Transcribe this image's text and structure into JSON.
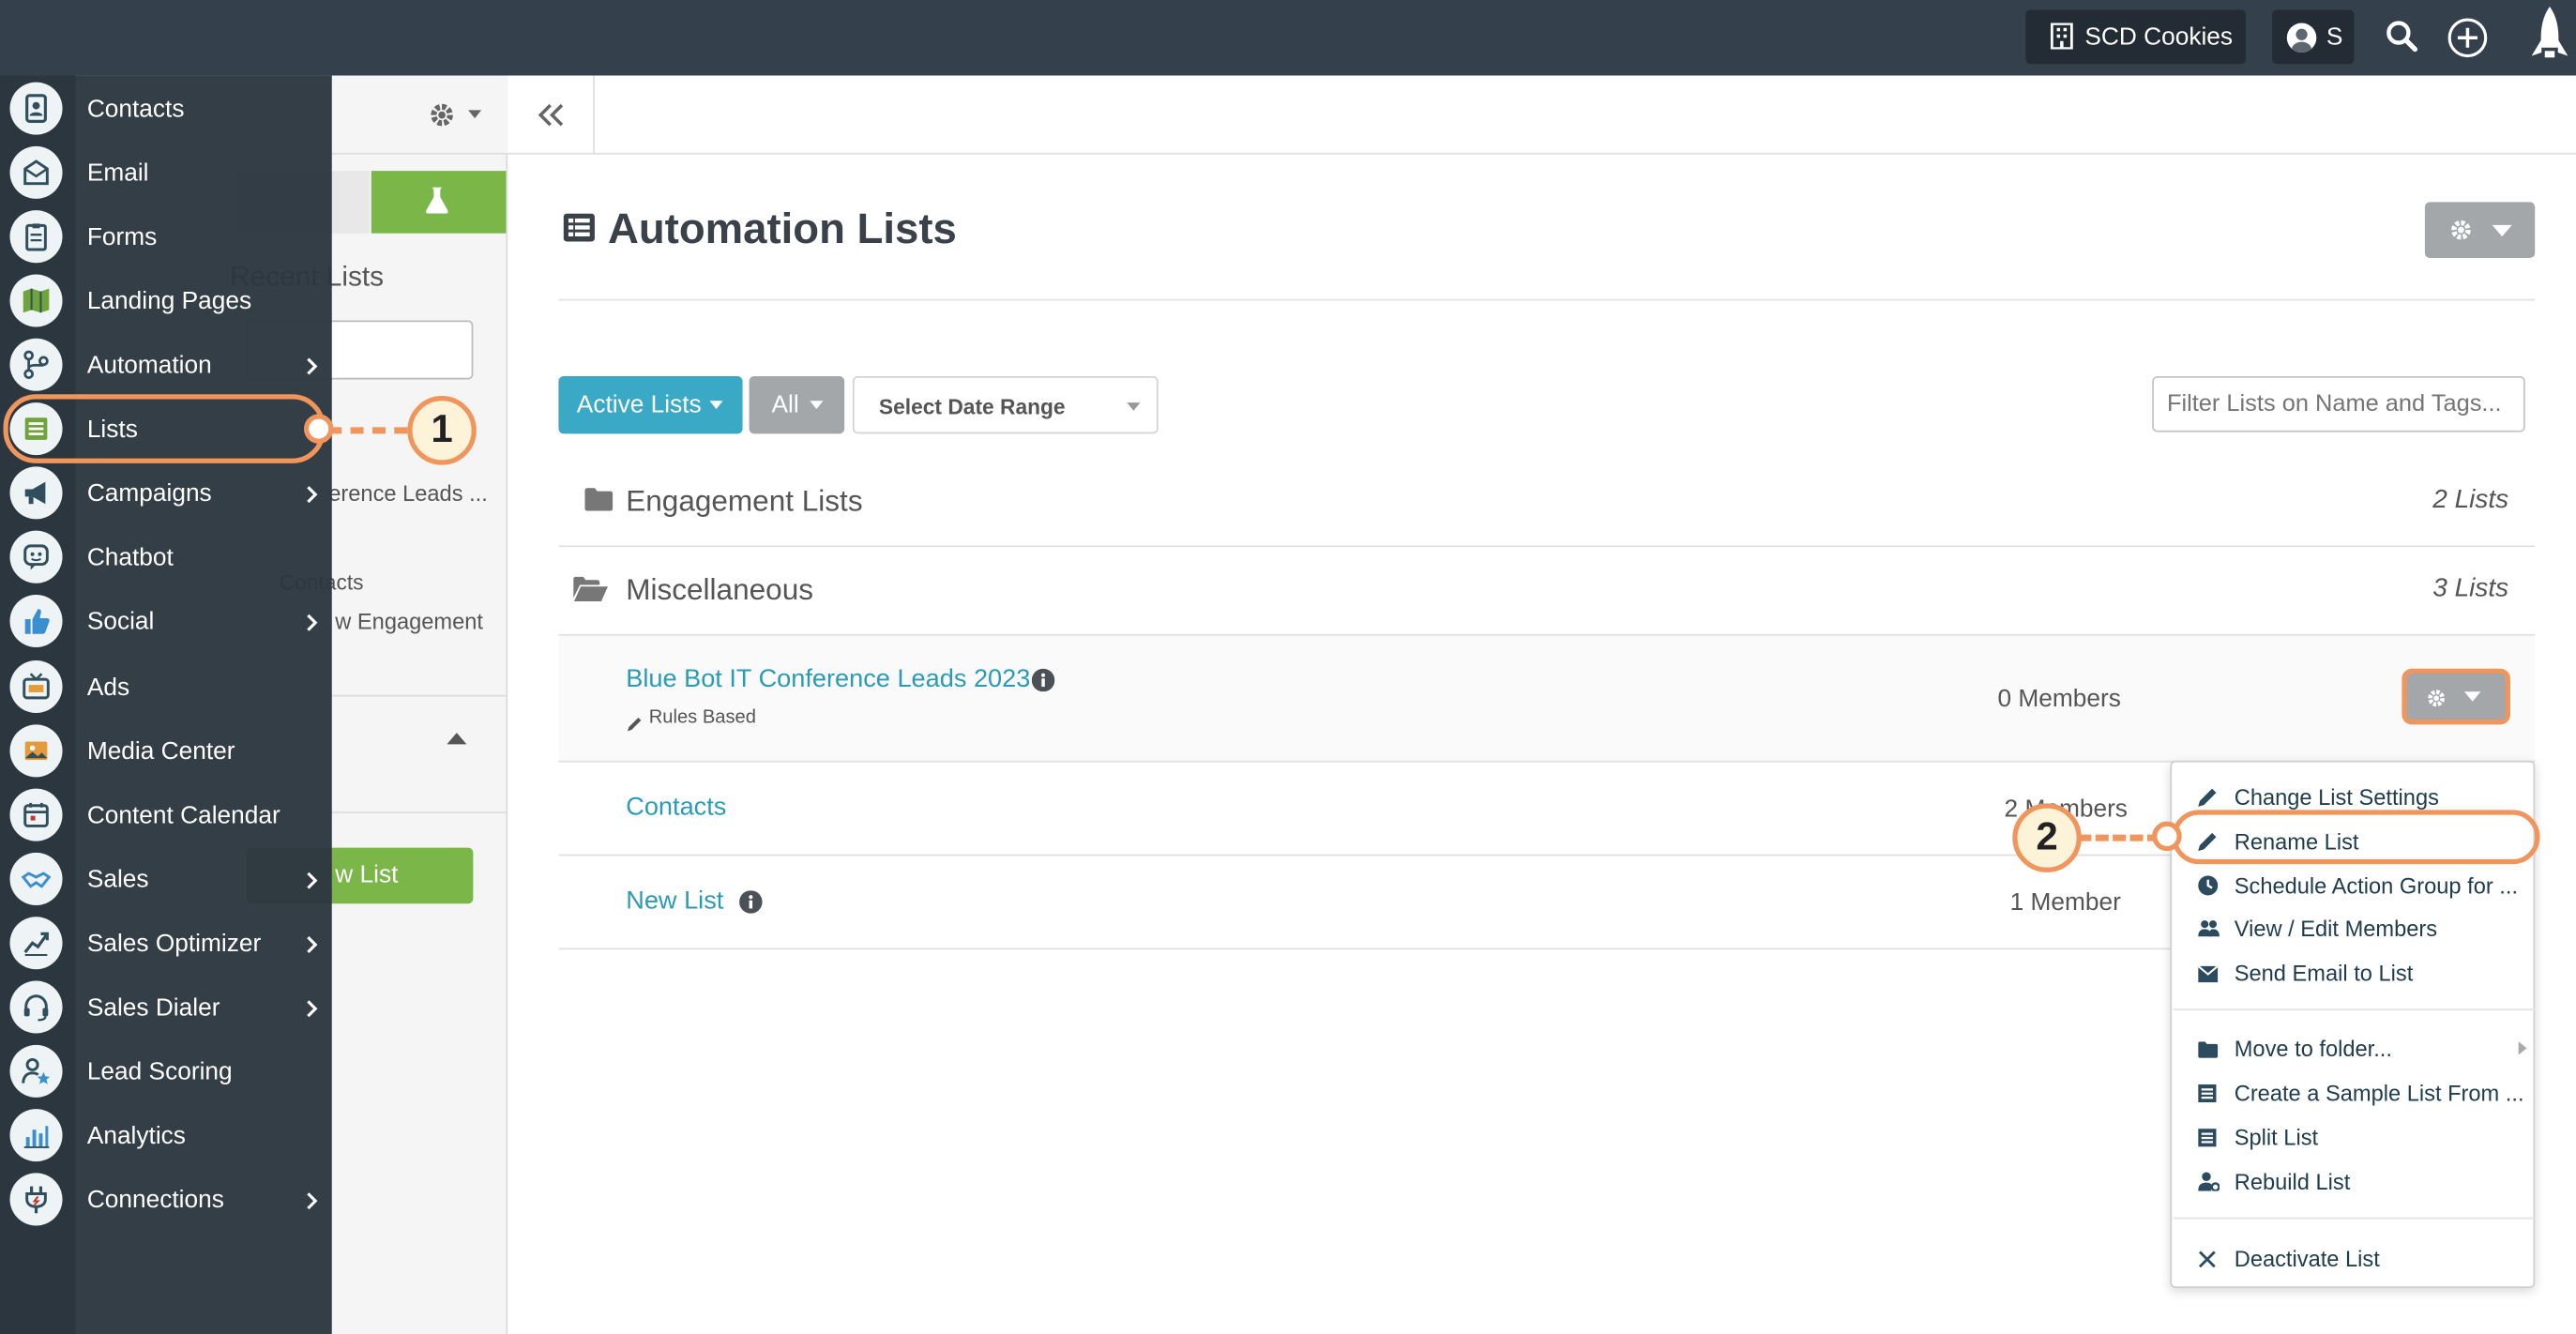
{
  "topbar": {
    "account_label": "SCD Cookies",
    "user_initial": "S"
  },
  "sidebar": {
    "items": [
      {
        "label": "Contacts",
        "has_submenu": false,
        "icon": "contacts-icon"
      },
      {
        "label": "Email",
        "has_submenu": false,
        "icon": "email-icon"
      },
      {
        "label": "Forms",
        "has_submenu": false,
        "icon": "forms-icon"
      },
      {
        "label": "Landing Pages",
        "has_submenu": false,
        "icon": "map-icon"
      },
      {
        "label": "Automation",
        "has_submenu": true,
        "icon": "automation-icon"
      },
      {
        "label": "Lists",
        "has_submenu": false,
        "icon": "list-icon"
      },
      {
        "label": "Campaigns",
        "has_submenu": true,
        "icon": "megaphone-icon"
      },
      {
        "label": "Chatbot",
        "has_submenu": false,
        "icon": "chatbot-icon"
      },
      {
        "label": "Social",
        "has_submenu": true,
        "icon": "thumbs-up-icon"
      },
      {
        "label": "Ads",
        "has_submenu": false,
        "icon": "tv-icon"
      },
      {
        "label": "Media Center",
        "has_submenu": false,
        "icon": "media-icon"
      },
      {
        "label": "Content Calendar",
        "has_submenu": false,
        "icon": "calendar-icon"
      },
      {
        "label": "Sales",
        "has_submenu": true,
        "icon": "handshake-icon"
      },
      {
        "label": "Sales Optimizer",
        "has_submenu": true,
        "icon": "chart-up-icon"
      },
      {
        "label": "Sales Dialer",
        "has_submenu": true,
        "icon": "headset-icon"
      },
      {
        "label": "Lead Scoring",
        "has_submenu": false,
        "icon": "user-star-icon"
      },
      {
        "label": "Analytics",
        "has_submenu": false,
        "icon": "bar-chart-icon"
      },
      {
        "label": "Connections",
        "has_submenu": true,
        "icon": "plug-icon"
      }
    ]
  },
  "behind_panel": {
    "recent_lists_heading": "Recent Lists",
    "recent_item_1": "erence Leads ...",
    "recent_item_2": "Contacts",
    "recent_item_3": "w Engagement",
    "new_list_button": "w List"
  },
  "main": {
    "title": "Automation Lists",
    "filters": {
      "active_lists": "Active Lists",
      "all": "All",
      "date_range": "Select Date Range",
      "search_placeholder": "Filter Lists on Name and Tags..."
    },
    "folders": [
      {
        "name": "Engagement Lists",
        "count": "2 Lists"
      },
      {
        "name": "Miscellaneous",
        "count": "3 Lists"
      }
    ],
    "lists": [
      {
        "name": "Blue Bot IT Conference Leads 2023",
        "tag": "Rules Based",
        "members": "0 Members"
      },
      {
        "name": "Contacts",
        "tag": "",
        "members": "2 Members"
      },
      {
        "name": "New List",
        "tag": "",
        "members": "1 Member"
      }
    ]
  },
  "dropdown": {
    "items": [
      {
        "label": "Change List Settings",
        "icon": "pencil-icon"
      },
      {
        "label": "Rename List",
        "icon": "pencil-icon"
      },
      {
        "label": "Schedule Action Group for ...",
        "icon": "clock-icon"
      },
      {
        "label": "View / Edit Members",
        "icon": "users-icon"
      },
      {
        "label": "Send Email to List",
        "icon": "envelope-icon"
      },
      {
        "label": "Move to folder...",
        "icon": "folder-icon"
      },
      {
        "label": "Create a Sample List From ...",
        "icon": "list-icon"
      },
      {
        "label": "Split List",
        "icon": "list-icon"
      },
      {
        "label": "Rebuild List",
        "icon": "user-cog-icon"
      },
      {
        "label": "Deactivate List",
        "icon": "close-icon"
      }
    ]
  },
  "callouts": {
    "one": "1",
    "two": "2"
  },
  "colors": {
    "accent": "#2a9bb7",
    "callout": "#f0955c",
    "green": "#7ab648",
    "topbar": "#34404c"
  }
}
